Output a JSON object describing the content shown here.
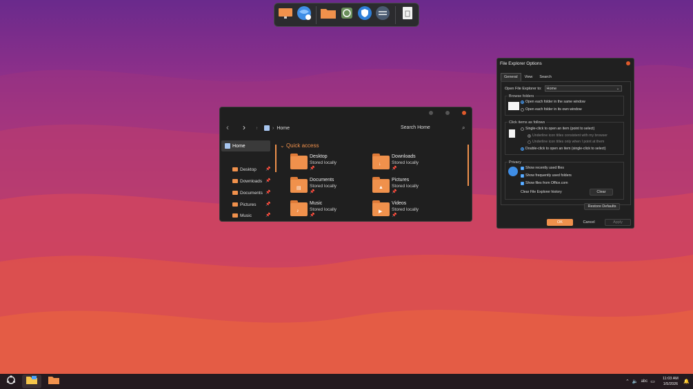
{
  "dock": {
    "items": [
      {
        "icon": "monitor-icon"
      },
      {
        "icon": "globe-icon"
      },
      {
        "icon": "folder-icon"
      },
      {
        "icon": "media-icon"
      },
      {
        "icon": "shield-icon"
      },
      {
        "icon": "settings-toggle-icon"
      },
      {
        "icon": "recycle-bin-icon"
      }
    ]
  },
  "explorer": {
    "address": "Home",
    "search_placeholder": "Search Home",
    "sidebar": {
      "home": "Home",
      "items": [
        {
          "label": "Desktop"
        },
        {
          "label": "Downloads"
        },
        {
          "label": "Documents"
        },
        {
          "label": "Pictures"
        },
        {
          "label": "Music"
        }
      ]
    },
    "quick_access_title": "Quick access",
    "tiles": [
      {
        "name": "Desktop",
        "status": "Stored locally",
        "glyph": ""
      },
      {
        "name": "Downloads",
        "status": "Stored locally",
        "glyph": "↓"
      },
      {
        "name": "Documents",
        "status": "Stored locally",
        "glyph": "▤"
      },
      {
        "name": "Pictures",
        "status": "Stored locally",
        "glyph": "▲"
      },
      {
        "name": "Music",
        "status": "Stored locally",
        "glyph": "♪"
      },
      {
        "name": "Videos",
        "status": "Stored locally",
        "glyph": "▶"
      }
    ],
    "pin_glyph": "📌"
  },
  "options": {
    "title": "File Explorer Options",
    "tabs": [
      "General",
      "View",
      "Search"
    ],
    "open_to_label": "Open File Explorer to:",
    "open_to_value": "Home",
    "browse_folders": {
      "label": "Browse folders",
      "options": [
        "Open each folder in the same window",
        "Open each folder in its own window"
      ]
    },
    "click_items": {
      "label": "Click items as follows",
      "options": [
        "Single-click to open an item (point to select)",
        "Underline icon titles consistent with my browser",
        "Underline icon titles only when I point at them",
        "Double-click to open an item (single-click to select)"
      ]
    },
    "privacy": {
      "label": "Privacy",
      "checks": [
        "Show recently used files",
        "Show frequently used folders",
        "Show files from Office.com"
      ],
      "clear_history_label": "Clear File Explorer history",
      "clear_button": "Clear"
    },
    "restore_button": "Restore Defaults",
    "ok_button": "OK",
    "cancel_button": "Cancel",
    "apply_button": "Apply"
  },
  "taskbar": {
    "time": "11:03 AM",
    "date": "1/5/2026"
  },
  "colors": {
    "accent": "#f0914c",
    "selection": "#4aa3ff"
  }
}
